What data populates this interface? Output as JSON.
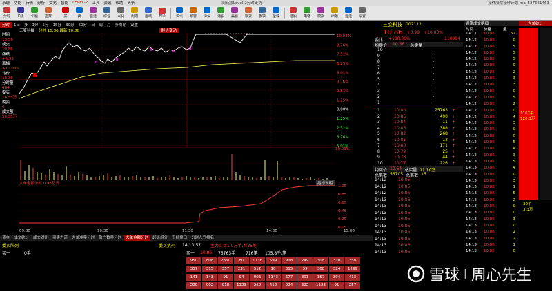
{
  "menu": {
    "items": [
      "系统",
      "功能",
      "行情",
      "分析",
      "交易",
      "智能",
      "LEVEL-2",
      "工具",
      "资讯",
      "帮助",
      "头条"
    ],
    "window_title": "同花顺Level-2分时走势",
    "right": "操作股票操作计划 ma_527661463"
  },
  "toolbar": {
    "items": [
      "分时",
      "K线",
      "个股",
      "指数",
      "买",
      "卖",
      "自选",
      "综合",
      "A股",
      "周期",
      "画线",
      "F10",
      "资讯",
      "预警",
      "沪深",
      "港股",
      "美股",
      "期货",
      "板块",
      "全球",
      "选股",
      "策略",
      "模拟",
      "研报",
      "自选",
      "设置"
    ]
  },
  "chart": {
    "tabs": [
      "分时",
      "1日",
      "多",
      "1分",
      "5分",
      "15分",
      "30分",
      "60分",
      "日",
      "周",
      "月",
      "多周期",
      "设置"
    ],
    "active_tab": "分时",
    "stock": "三变科技",
    "info": "分时 10:36 最新 10.86",
    "trend_label": "股价变动",
    "price_levels": [
      "10.03%",
      "8.76%",
      "7.51%",
      "6.25%",
      "5.01%",
      "3.76%",
      "2.51%",
      "1.25%",
      "0.00%"
    ],
    "pct_levels": [
      "10.03%",
      "8.76%",
      "7.51%",
      "6.25%",
      "5.01%",
      "3.76%",
      "2.51%",
      "1.25%",
      "0.00%",
      "1.25%",
      "2.51%",
      "3.76%",
      "5.01%"
    ],
    "left_prices": [
      "10.86",
      "10.71",
      "10.59",
      "10.47",
      "10.35",
      "10.23",
      "10.13",
      "10.01",
      "9.87",
      "9.75",
      "9.63",
      "9.51",
      "9.38",
      "9.26"
    ],
    "vol_labels": [
      "33053",
      "16789"
    ],
    "vol_pct": "10.03%",
    "big_order_title": "大单金额分时 0.93亿元",
    "big_order_tick": "指标说明",
    "big_levels": [
      "1.05",
      "0.85",
      "0.65",
      "0.45",
      "0.25",
      "0.05"
    ],
    "time_axis": [
      "09:30",
      "10:30",
      "11:30",
      "14:00",
      "15:00"
    ]
  },
  "left_panel": {
    "lines": [
      "时间",
      "13:59",
      "成交",
      "10.86",
      "涨跌",
      "+0.99",
      "涨幅",
      "+10.03%",
      "均价",
      "10.36",
      "分时量",
      "464",
      "委买",
      "16.55万",
      "委卖",
      "0",
      "成交额",
      "50.35万"
    ]
  },
  "bottom_tabs": [
    "资金",
    "成交统计",
    "成交对比",
    "买卖力道",
    "大单净量分时",
    "散户数量分时",
    "大单金额分时",
    "超级组分",
    "千档盘口",
    "分时人气排名"
  ],
  "queue": {
    "title": "委买队列",
    "subtitle": "委买执列",
    "time": "14:13:57",
    "b1": "买一",
    "price": "10.86",
    "vol": "75763手",
    "count": "716笔",
    "amt": "105.8千/笔",
    "note": "主力买单1.0万手,共35笔",
    "row_label": "买一",
    "row_value": "0手",
    "cells": [
      [
        "950",
        "808",
        "2860",
        "80",
        "1136",
        "599",
        "918",
        "249",
        "308",
        "310",
        "358"
      ],
      [
        "357",
        "315",
        "357",
        "231",
        "512",
        "10",
        "315",
        "39",
        "308",
        "324",
        "1299"
      ],
      [
        "141",
        "143",
        "91",
        "94",
        "906",
        "1143",
        "677",
        "801",
        "157",
        "394",
        "413"
      ],
      [
        "229",
        "902",
        "918",
        "1123",
        "260",
        "412",
        "924",
        "322",
        "1123",
        "91",
        "257"
      ]
    ]
  },
  "quote": {
    "name": "三变科技",
    "code": "002112",
    "price": "10.86",
    "chg": "+0.99",
    "pct": "+10.03%",
    "wei_bi": "+100.00%",
    "wei_cha": "110994",
    "jun_mai": "10.86",
    "zong_mai": "",
    "sell": [
      [
        "10",
        "",
        "",
        ""
      ],
      [
        "9",
        "",
        "",
        ""
      ],
      [
        "8",
        "",
        "",
        ""
      ],
      [
        "7",
        "",
        "",
        ""
      ],
      [
        "6",
        "",
        "",
        ""
      ],
      [
        "5",
        "",
        "",
        ""
      ],
      [
        "4",
        "",
        "",
        ""
      ],
      [
        "3",
        "",
        "",
        ""
      ],
      [
        "2",
        "",
        "",
        ""
      ],
      [
        "1",
        "",
        "",
        ""
      ]
    ],
    "buy": [
      [
        "1",
        "10.86",
        "75763",
        "+"
      ],
      [
        "2",
        "10.85",
        "490",
        "+"
      ],
      [
        "3",
        "10.84",
        "11",
        "+"
      ],
      [
        "4",
        "10.83",
        "388",
        "+"
      ],
      [
        "5",
        "10.82",
        "268",
        "+"
      ],
      [
        "6",
        "10.81",
        "13",
        "+"
      ],
      [
        "7",
        "10.80",
        "171",
        "+"
      ],
      [
        "8",
        "10.79",
        "25",
        "+"
      ],
      [
        "9",
        "10.78",
        "44",
        "+"
      ],
      [
        "10",
        "10.77",
        "226",
        "+"
      ]
    ],
    "avg_buy": "10.54",
    "total_buy": "11.10万",
    "buy_count": "55705",
    "total_count": "15",
    "ticks": [
      [
        "14:12",
        "10.86",
        "",
        ""
      ],
      [
        "14:12",
        "10.86",
        "",
        ""
      ],
      [
        "14:12",
        "10.86",
        "",
        ""
      ],
      [
        "14:13",
        "10.86",
        "",
        ""
      ],
      [
        "14:13",
        "10.86",
        "",
        ""
      ],
      [
        "14:13",
        "10.86",
        "",
        ""
      ],
      [
        "14:13",
        "10.86",
        "",
        ""
      ],
      [
        "14:13",
        "10.86",
        "",
        ""
      ],
      [
        "14:13",
        "10.86",
        "",
        ""
      ],
      [
        "14:13",
        "10.86",
        "",
        ""
      ],
      [
        "14:13",
        "10.86",
        "",
        ""
      ],
      [
        "14:13",
        "10.86",
        "",
        ""
      ]
    ]
  },
  "tick": {
    "header": [
      "时间",
      "价格",
      "量"
    ],
    "rows": [
      [
        "14:11",
        "10.86",
        "52"
      ],
      [
        "14:12",
        "10.86",
        "0"
      ],
      [
        "14:12",
        "10.86",
        "5"
      ],
      [
        "14:12",
        "10.86",
        "5"
      ],
      [
        "14:12",
        "10.86",
        "5"
      ],
      [
        "14:12",
        "10.86",
        "0"
      ],
      [
        "14:12",
        "10.86",
        "2"
      ],
      [
        "14:12",
        "10.86",
        "3"
      ],
      [
        "14:12",
        "10.86",
        "3"
      ],
      [
        "14:12",
        "10.86",
        "0"
      ],
      [
        "14:12",
        "10.86",
        "5"
      ],
      [
        "14:12",
        "10.86",
        "2"
      ],
      [
        "14:12",
        "10.86",
        "0"
      ],
      [
        "14:12",
        "10.86",
        "4"
      ],
      [
        "14:12",
        "10.86",
        "3"
      ],
      [
        "14:12",
        "10.86",
        "0"
      ],
      [
        "14:12",
        "10.86",
        "0"
      ],
      [
        "14:12",
        "10.86",
        "5"
      ],
      [
        "14:12",
        "10.86",
        "4"
      ],
      [
        "14:12",
        "10.86",
        "3"
      ],
      [
        "14:13",
        "10.86",
        "5"
      ],
      [
        "14:13",
        "10.86",
        "4"
      ],
      [
        "14:13",
        "10.86",
        "0"
      ],
      [
        "14:13",
        "10.86",
        "3"
      ],
      [
        "14:13",
        "10.86",
        "1"
      ],
      [
        "14:13",
        "10.86",
        "5"
      ],
      [
        "14:13",
        "10.86",
        "2"
      ],
      [
        "14:13",
        "10.86",
        "0"
      ],
      [
        "14:13",
        "10.86",
        "0"
      ],
      [
        "14:13",
        "10.86",
        "3"
      ],
      [
        "14:13",
        "10.86",
        "0"
      ],
      [
        "14:13",
        "10.86",
        "2"
      ],
      [
        "14:13",
        "10.86",
        "2"
      ],
      [
        "14:13",
        "10.86",
        "1"
      ],
      [
        "14:13",
        "10.86",
        "0"
      ]
    ],
    "title": "逐笔成交明细"
  },
  "right_bar": {
    "label": "大单统计",
    "top": "大单",
    "value1": "1107手",
    "value2": "120.3万",
    "bottom1": "30手",
    "bottom2": "3.3万"
  },
  "watermark": {
    "text1": "雪球",
    "text2": "周心先生"
  }
}
